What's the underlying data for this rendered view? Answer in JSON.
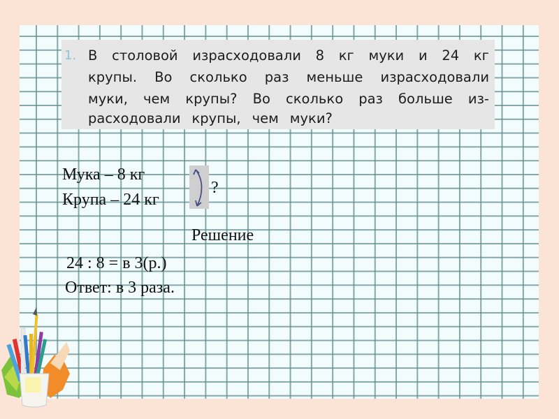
{
  "task": {
    "number": "1.",
    "lines": [
      [
        "В",
        "столовой",
        "израсходовали",
        "8",
        "кг",
        "муки",
        "и",
        "24",
        "кг"
      ],
      [
        "крупы.",
        "Во",
        "сколько",
        "раз",
        "меньше",
        "израсходовали"
      ],
      [
        "муки,",
        "чем",
        "крупы?",
        "Во",
        "сколько",
        "раз",
        "больше",
        "из-"
      ],
      [
        "расходовали",
        "крупы,",
        "чем",
        "муки?"
      ]
    ]
  },
  "condition": {
    "line1": "Мука – 8 кг",
    "line2": "Крупа – 24 кг",
    "question_mark": "?",
    "arrow_icon": "double-headed-curved-arrow"
  },
  "solution": {
    "heading": "Решение",
    "equation": "24 : 8 = в 3(р.)",
    "answer": "Ответ: в 3 раза."
  },
  "decoration": {
    "icon": "pencil-cup-with-leaves"
  },
  "colors": {
    "background": "#fbe3d6",
    "paper": "#f3fcfd",
    "grid_line": "#5f8c8c",
    "task_box": "#e6e6e6",
    "task_number": "#8cc4dc",
    "arrow": "#4a4e86"
  }
}
